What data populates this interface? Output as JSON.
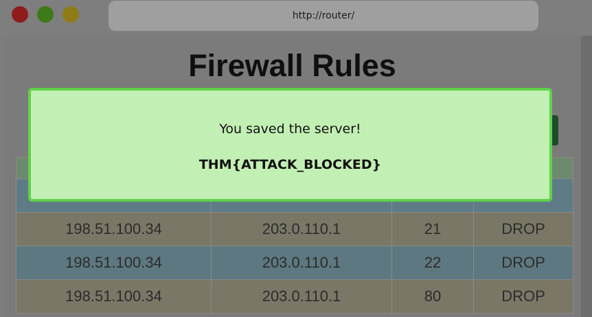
{
  "browser": {
    "url": "http://router/",
    "controls": [
      "close",
      "minimize",
      "maximize"
    ]
  },
  "page": {
    "title": "Firewall Rules"
  },
  "table": {
    "rows": [
      {
        "source": "198.51.100.34",
        "destination": "203.0.110.1",
        "port": "21",
        "action": "DROP"
      },
      {
        "source": "198.51.100.34",
        "destination": "203.0.110.1",
        "port": "22",
        "action": "DROP"
      },
      {
        "source": "198.51.100.34",
        "destination": "203.0.110.1",
        "port": "80",
        "action": "DROP"
      }
    ]
  },
  "modal": {
    "message": "You saved the server!",
    "flag": "THM{ATTACK_BLOCKED}"
  },
  "colors": {
    "modal_bg": "#c2efb3",
    "modal_border": "#5fd24a"
  }
}
